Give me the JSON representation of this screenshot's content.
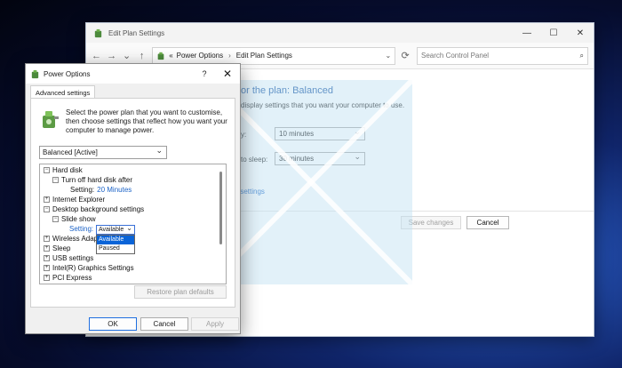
{
  "edit_plan": {
    "window_title": "Edit Plan Settings",
    "breadcrumb": {
      "prefix": "«",
      "items": [
        "Power Options",
        "Edit Plan Settings"
      ]
    },
    "search_placeholder": "Search Control Panel",
    "heading_partial": "or the plan: Balanced",
    "description_partial": "display settings that you want your computer to use.",
    "row1_label_partial": "y:",
    "row1_value": "10 minutes",
    "row2_label_partial": "to sleep:",
    "row2_value": "30 minutes",
    "advanced_link_partial": "er settings",
    "save_label": "Save changes",
    "cancel_label": "Cancel"
  },
  "power_options": {
    "title": "Power Options",
    "help_glyph": "?",
    "close_glyph": "✕",
    "tab_label": "Advanced settings",
    "intro": "Select the power plan that you want to customise, then choose settings that reflect how you want your computer to manage power.",
    "plan_selected": "Balanced [Active]",
    "tree": {
      "hard_disk": "Hard disk",
      "turn_off_hd": "Turn off hard disk after",
      "hd_setting_label": "Setting:",
      "hd_setting_value": "20 Minutes",
      "internet_explorer": "Internet Explorer",
      "desktop_bg": "Desktop background settings",
      "slide_show": "Slide show",
      "slide_setting_label": "Setting:",
      "slide_setting_value": "Available",
      "wireless_partial": "Wireless Adap",
      "sleep": "Sleep",
      "usb": "USB settings",
      "intel": "Intel(R) Graphics Settings",
      "pci_partial": "PCI Express"
    },
    "dropdown_options": [
      "Available",
      "Paused"
    ],
    "restore_label": "Restore plan defaults",
    "ok_label": "OK",
    "cancel_label": "Cancel",
    "apply_label": "Apply"
  }
}
